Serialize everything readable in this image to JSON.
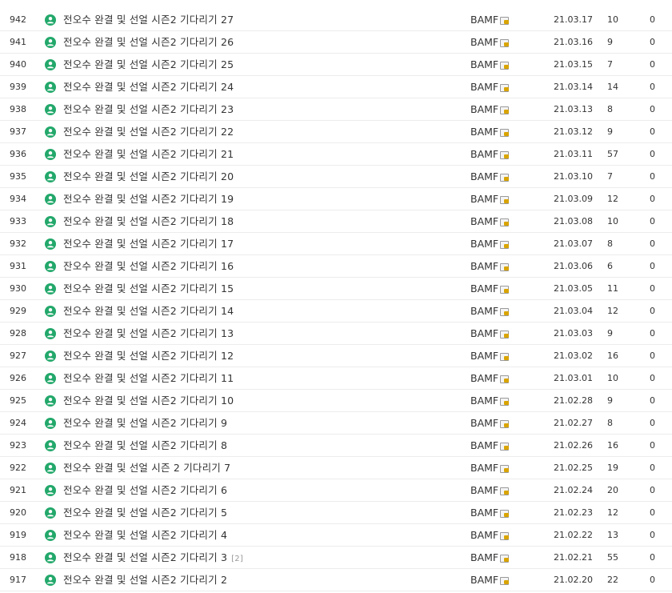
{
  "colors": {
    "icon": "#23a86b",
    "row_border": "#ececec",
    "comment_count": "#999999"
  },
  "posts": [
    {
      "num": "942",
      "title": "전오수 완결 및 선얼 시즌2 기다리기 27",
      "comments": "",
      "author": "BAMF",
      "date": "21.03.17",
      "views": "10",
      "likes": "0"
    },
    {
      "num": "941",
      "title": "전오수 완결 및 선얼 시즌2 기다리기 26",
      "comments": "",
      "author": "BAMF",
      "date": "21.03.16",
      "views": "9",
      "likes": "0"
    },
    {
      "num": "940",
      "title": "전오수 완결 및 선얼 시즌2 기다리기 25",
      "comments": "",
      "author": "BAMF",
      "date": "21.03.15",
      "views": "7",
      "likes": "0"
    },
    {
      "num": "939",
      "title": "전오수 완결 및 선얼 시즌2 기다리기 24",
      "comments": "",
      "author": "BAMF",
      "date": "21.03.14",
      "views": "14",
      "likes": "0"
    },
    {
      "num": "938",
      "title": "전오수 완결 및 선얼 시즌2 기다리기 23",
      "comments": "",
      "author": "BAMF",
      "date": "21.03.13",
      "views": "8",
      "likes": "0"
    },
    {
      "num": "937",
      "title": "전오수 완결 및 선얼 시즌2 기다리기 22",
      "comments": "",
      "author": "BAMF",
      "date": "21.03.12",
      "views": "9",
      "likes": "0"
    },
    {
      "num": "936",
      "title": "전오수 완결 및 선얼 시즌2 기다리기 21",
      "comments": "",
      "author": "BAMF",
      "date": "21.03.11",
      "views": "57",
      "likes": "0"
    },
    {
      "num": "935",
      "title": "전오수 완결 및 선얼 시즌2 기다리기 20",
      "comments": "",
      "author": "BAMF",
      "date": "21.03.10",
      "views": "7",
      "likes": "0"
    },
    {
      "num": "934",
      "title": "전오수 완결 및 선얼 시즌2 기다리기 19",
      "comments": "",
      "author": "BAMF",
      "date": "21.03.09",
      "views": "12",
      "likes": "0"
    },
    {
      "num": "933",
      "title": "전오수 완결 및 선얼 시즌2 기다리기 18",
      "comments": "",
      "author": "BAMF",
      "date": "21.03.08",
      "views": "10",
      "likes": "0"
    },
    {
      "num": "932",
      "title": "전오수 완결 및 선얼 시즌2 기다리기 17",
      "comments": "",
      "author": "BAMF",
      "date": "21.03.07",
      "views": "8",
      "likes": "0"
    },
    {
      "num": "931",
      "title": "잔오수 완결 및 선얼 시즌2 기다리기 16",
      "comments": "",
      "author": "BAMF",
      "date": "21.03.06",
      "views": "6",
      "likes": "0"
    },
    {
      "num": "930",
      "title": "전오수 완결 및 선얼 시즌2 기다리기 15",
      "comments": "",
      "author": "BAMF",
      "date": "21.03.05",
      "views": "11",
      "likes": "0"
    },
    {
      "num": "929",
      "title": "전오수 완결 및 선얼 시즌2 기다리기 14",
      "comments": "",
      "author": "BAMF",
      "date": "21.03.04",
      "views": "12",
      "likes": "0"
    },
    {
      "num": "928",
      "title": "전오수 완결 및 선얼 시즌2 기다리기 13",
      "comments": "",
      "author": "BAMF",
      "date": "21.03.03",
      "views": "9",
      "likes": "0"
    },
    {
      "num": "927",
      "title": "전오수 완결 및 선얼 시즌2 기다리기 12",
      "comments": "",
      "author": "BAMF",
      "date": "21.03.02",
      "views": "16",
      "likes": "0"
    },
    {
      "num": "926",
      "title": "전오수 완결 및 선얼 시즌2 기다리기 11",
      "comments": "",
      "author": "BAMF",
      "date": "21.03.01",
      "views": "10",
      "likes": "0"
    },
    {
      "num": "925",
      "title": "전오수 완결 및 선얼 시즌2 기다리기 10",
      "comments": "",
      "author": "BAMF",
      "date": "21.02.28",
      "views": "9",
      "likes": "0"
    },
    {
      "num": "924",
      "title": "전오수 완결 및 선얼 시즌2 기다리기 9",
      "comments": "",
      "author": "BAMF",
      "date": "21.02.27",
      "views": "8",
      "likes": "0"
    },
    {
      "num": "923",
      "title": "전오수 완결 및 선얼 시즌2 기다리기 8",
      "comments": "",
      "author": "BAMF",
      "date": "21.02.26",
      "views": "16",
      "likes": "0"
    },
    {
      "num": "922",
      "title": "전오수 완결 및 선얼 시즌 2 기다리기 7",
      "comments": "",
      "author": "BAMF",
      "date": "21.02.25",
      "views": "19",
      "likes": "0"
    },
    {
      "num": "921",
      "title": "전오수 완결 및 선얼 시즌2 기다리기 6",
      "comments": "",
      "author": "BAMF",
      "date": "21.02.24",
      "views": "20",
      "likes": "0"
    },
    {
      "num": "920",
      "title": "전오수 완결 및 선얼 시즌2 기다리기 5",
      "comments": "",
      "author": "BAMF",
      "date": "21.02.23",
      "views": "12",
      "likes": "0"
    },
    {
      "num": "919",
      "title": "전오수 완결 및 선얼 시즌2 기다리기 4",
      "comments": "",
      "author": "BAMF",
      "date": "21.02.22",
      "views": "13",
      "likes": "0"
    },
    {
      "num": "918",
      "title": "전오수 완결 및 선얼 시즌2 기다리기 3",
      "comments": "[2]",
      "author": "BAMF",
      "date": "21.02.21",
      "views": "55",
      "likes": "0"
    },
    {
      "num": "917",
      "title": "전오수 완결 및 선얼 시즌2 기다리기 2",
      "comments": "",
      "author": "BAMF",
      "date": "21.02.20",
      "views": "22",
      "likes": "0"
    }
  ]
}
